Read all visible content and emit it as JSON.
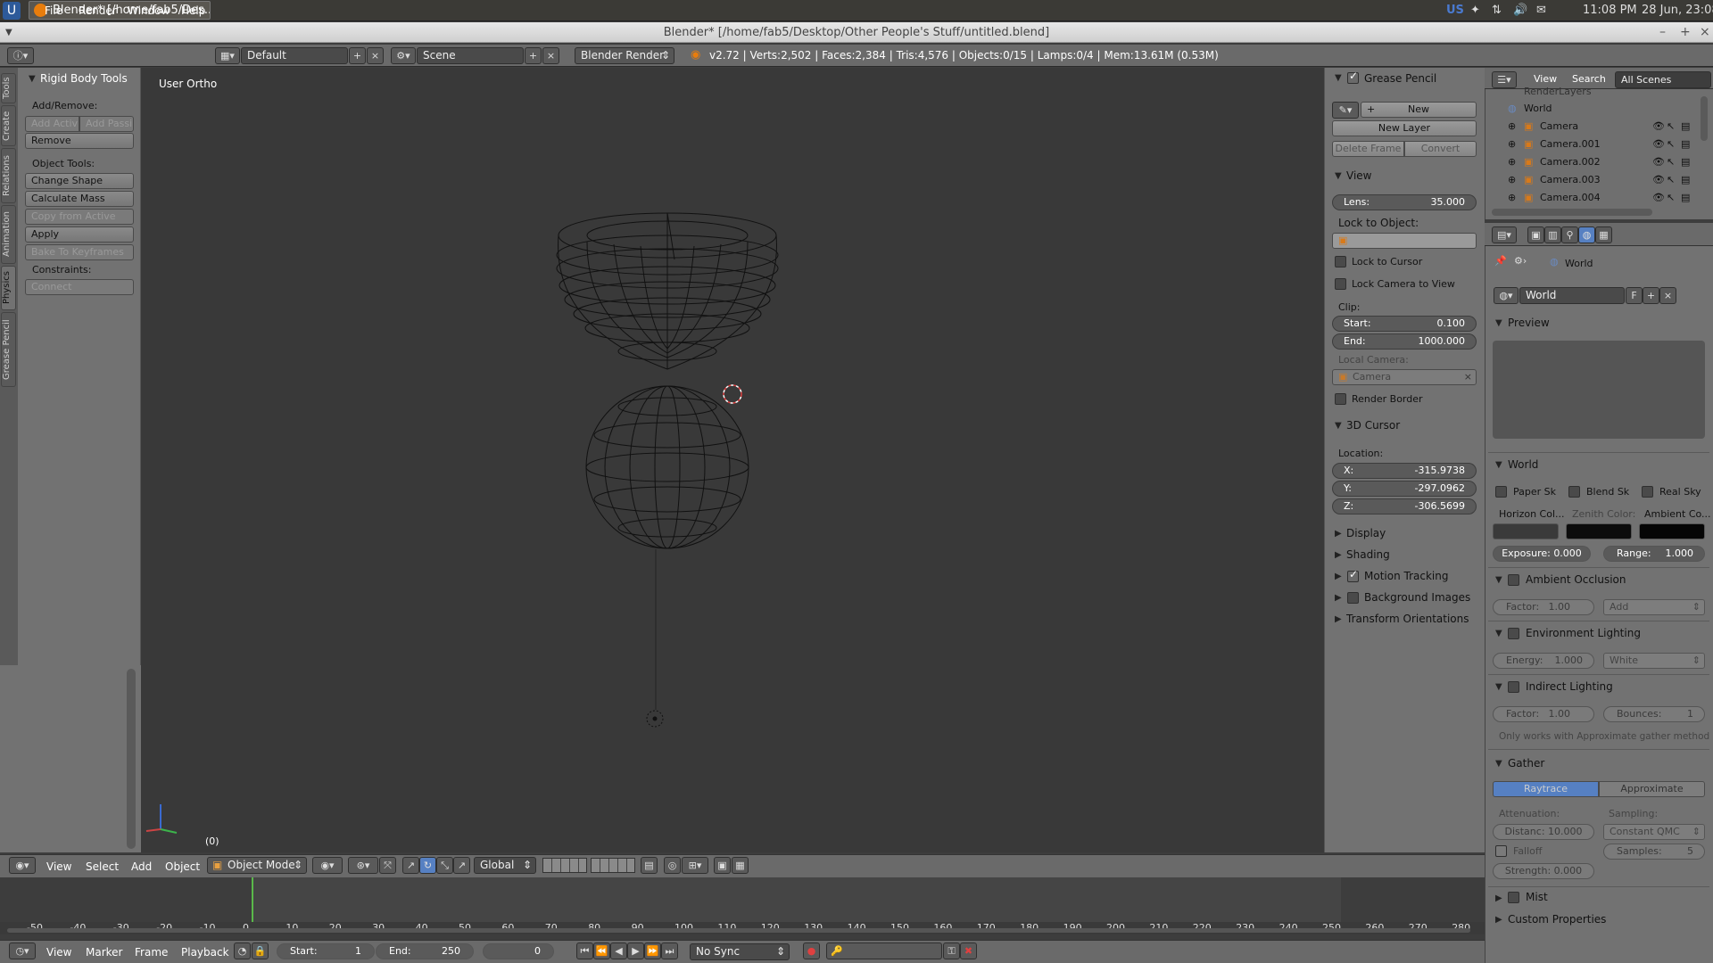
{
  "os": {
    "task_title": "Blender* [/home/fab5/Des...",
    "tray_lang": "US",
    "clock": "11:08 PM",
    "date": "28 Jun, 23:08"
  },
  "window": {
    "title": "Blender* [/home/fab5/Desktop/Other People's Stuff/untitled.blend]"
  },
  "menubar": {
    "items": [
      "File",
      "Render",
      "Window",
      "Help"
    ],
    "layout": "Default",
    "scene": "Scene",
    "engine": "Blender Render",
    "stats": "v2.72 | Verts:2,502 | Faces:2,384 | Tris:4,576 | Objects:0/15 | Lamps:0/4 | Mem:13.61M (0.53M)"
  },
  "left_tabs": [
    "Tools",
    "Create",
    "Relations",
    "Animation",
    "Physics",
    "Grease Pencil"
  ],
  "toolshelf": {
    "title": "Rigid Body Tools",
    "add_remove": "Add/Remove:",
    "add_active": "Add Activ",
    "add_passive": "Add Passi",
    "remove": "Remove",
    "object_tools": "Object Tools:",
    "change_shape": "Change Shape",
    "calculate_mass": "Calculate Mass",
    "copy_from_active": "Copy from Active",
    "apply_transformation": "Apply Transformation",
    "bake_to_keyframes": "Bake To Keyframes",
    "constraints": "Constraints:",
    "connect": "Connect"
  },
  "viewport": {
    "label": "User Ortho",
    "frame": "(0)"
  },
  "npanel": {
    "grease_pencil": "Grease Pencil",
    "new": "New",
    "new_layer": "New Layer",
    "delete_frame": "Delete Frame",
    "convert": "Convert",
    "view": "View",
    "lens_label": "Lens:",
    "lens_value": "35.000",
    "lock_to_object": "Lock to Object:",
    "lock_to_cursor": "Lock to Cursor",
    "lock_camera_to_view": "Lock Camera to View",
    "clip": "Clip:",
    "start_label": "Start:",
    "start_value": "0.100",
    "end_label": "End:",
    "end_value": "1000.000",
    "local_camera": "Local Camera:",
    "camera": "Camera",
    "render_border": "Render Border",
    "cursor_3d": "3D Cursor",
    "location": "Location:",
    "x_label": "X:",
    "x_value": "-315.9738",
    "y_label": "Y:",
    "y_value": "-297.0962",
    "z_label": "Z:",
    "z_value": "-306.5699",
    "display": "Display",
    "shading": "Shading",
    "motion_tracking": "Motion Tracking",
    "background_images": "Background Images",
    "transform_orientations": "Transform Orientations"
  },
  "outliner": {
    "view": "View",
    "search": "Search",
    "scope": "All Scenes",
    "items": [
      "RenderLayers",
      "World",
      "Camera",
      "Camera.001",
      "Camera.002",
      "Camera.003",
      "Camera.004"
    ]
  },
  "properties": {
    "breadcrumb": "World",
    "world_name": "World",
    "fake_user": "F",
    "preview": "Preview",
    "world_panel": "World",
    "paper_sky": "Paper Sk",
    "blend_sky": "Blend Sk",
    "real_sky": "Real Sky",
    "horizon_color": "Horizon Col...",
    "zenith_color": "Zenith Color:",
    "ambient_color": "Ambient Co...",
    "exposure": "Exposure: 0.000",
    "range": "Range:",
    "range_value": "1.000",
    "ambient_occlusion": "Ambient Occlusion",
    "ao_factor": "Factor:",
    "ao_factor_value": "1.00",
    "ao_mode": "Add",
    "environment_lighting": "Environment Lighting",
    "energy": "Energy:",
    "energy_value": "1.000",
    "env_color": "White",
    "indirect_lighting": "Indirect Lighting",
    "il_factor": "Factor:",
    "il_factor_value": "1.00",
    "bounces": "Bounces:",
    "bounces_value": "1",
    "il_note": "Only works with Approximate gather method",
    "gather": "Gather",
    "raytrace": "Raytrace",
    "approximate": "Approximate",
    "attenuation": "Attenuation:",
    "sampling": "Sampling:",
    "distance": "Distanc: 10.000",
    "sampling_mode": "Constant QMC",
    "falloff": "Falloff",
    "samples": "Samples:",
    "samples_value": "5",
    "strength": "Strength: 0.000",
    "mist": "Mist",
    "custom_properties": "Custom Properties"
  },
  "viewport_header": {
    "items": [
      "View",
      "Select",
      "Add",
      "Object"
    ],
    "mode": "Object Mode",
    "orientation": "Global"
  },
  "timeline": {
    "ruler": [
      "-50",
      "-40",
      "-30",
      "-20",
      "-10",
      "0",
      "10",
      "20",
      "30",
      "40",
      "50",
      "60",
      "70",
      "80",
      "90",
      "100",
      "110",
      "120",
      "130",
      "140",
      "150",
      "160",
      "170",
      "180",
      "190",
      "200",
      "210",
      "220",
      "230",
      "240",
      "250",
      "260",
      "270",
      "280"
    ],
    "menu": [
      "View",
      "Marker",
      "Frame",
      "Playback"
    ],
    "start_label": "Start:",
    "start_value": "1",
    "end_label": "End:",
    "end_value": "250",
    "current": "0",
    "sync": "No Sync"
  }
}
